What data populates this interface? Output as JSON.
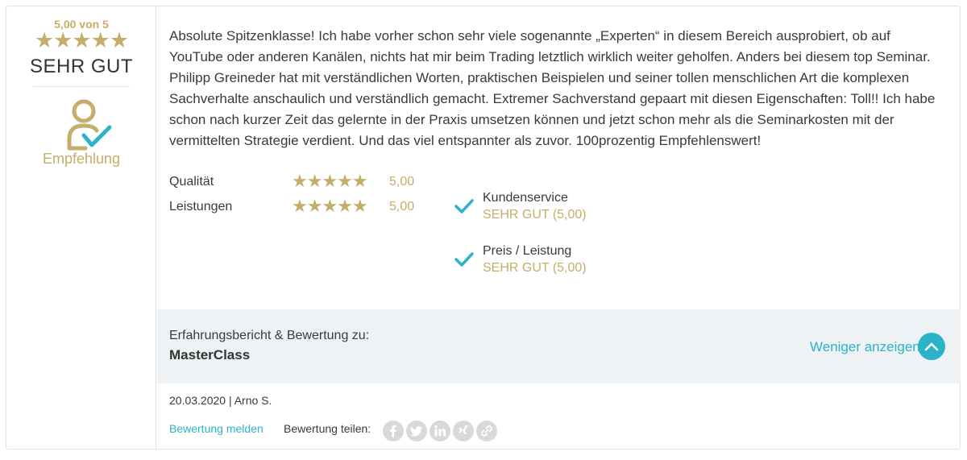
{
  "summary": {
    "score_text": "5,00 von 5",
    "star_count": 5,
    "verdict": "SEHR GUT",
    "recommendation_label": "Empfehlung"
  },
  "review": {
    "text": "Absolute Spitzenklasse! Ich habe vorher schon sehr viele sogenannte „Experten“ in diesem Bereich ausprobiert, ob auf YouTube oder anderen Kanälen, nichts hat mir beim Trading letztlich wirklich weiter geholfen. Anders bei diesem top Seminar. Philipp Greineder hat mit verständlichen Worten, praktischen Beispielen und seiner tollen menschlichen Art die komplexen Sachverhalte anschaulich und verständlich gemacht. Extremer Sachverstand gepaart mit diesen Eigenschaften: Toll!! Ich habe schon nach kurzer Zeit das gelernte in der Praxis umsetzen können und jetzt schon mehr als die Seminarkosten mit der vermittelten Strategie verdient. Und das viel entspannter als zuvor. 100prozentig Empfehlenswert!"
  },
  "ratings": [
    {
      "label": "Qualität",
      "stars": 5,
      "value": "5,00"
    },
    {
      "label": "Leistungen",
      "stars": 5,
      "value": "5,00"
    }
  ],
  "services": [
    {
      "title": "Kundenservice",
      "value": "SEHR GUT (5,00)"
    },
    {
      "title": "Preis / Leistung",
      "value": "SEHR GUT (5,00)"
    }
  ],
  "product": {
    "caption": "Erfahrungsbericht & Bewertung zu:",
    "name": "MasterClass",
    "toggle_label": "Weniger anzeigen"
  },
  "meta": {
    "date_author": "20.03.2020 | Arno S."
  },
  "actions": {
    "report_label": "Bewertung melden",
    "share_label": "Bewertung teilen:",
    "share_icons": [
      "facebook-icon",
      "twitter-icon",
      "linkedin-icon",
      "xing-icon",
      "link-icon"
    ]
  },
  "colors": {
    "gold": "#c5ad6a",
    "accent": "#2bb3c9",
    "text": "#3a3a3a",
    "panel": "#eff2f4",
    "share_grey": "#d9d9d9"
  }
}
